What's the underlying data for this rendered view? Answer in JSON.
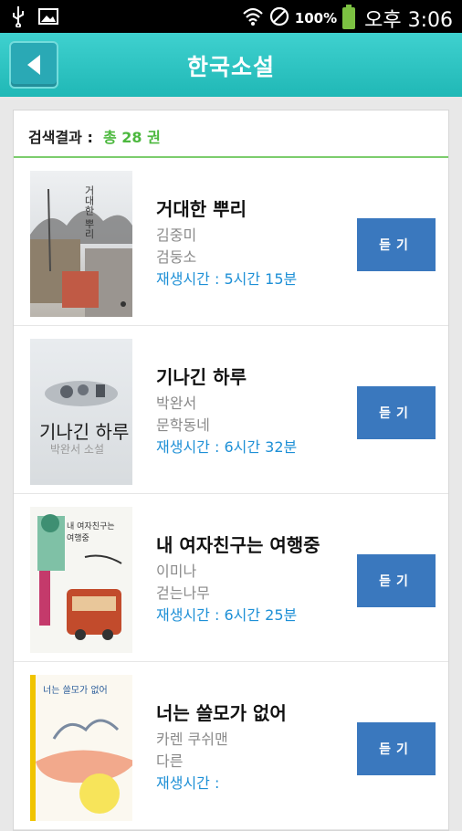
{
  "status": {
    "battery_pct": "100%",
    "time": "오후 3:06"
  },
  "header": {
    "title": "한국소설"
  },
  "results": {
    "label": "검색결과 :",
    "count": "총 28 권"
  },
  "books": [
    {
      "title": "거대한 뿌리",
      "author": "김중미",
      "publisher": "검둥소",
      "duration": "재생시간 : 5시간 15분",
      "button": "듣기",
      "cover_text": "거대한 뿌리"
    },
    {
      "title": "기나긴 하루",
      "author": "박완서",
      "publisher": "문학동네",
      "duration": "재생시간 : 6시간 32분",
      "button": "듣기",
      "cover_text": "기나긴 하루",
      "cover_sub": "박완서 소설"
    },
    {
      "title": "내 여자친구는 여행중",
      "author": "이미나",
      "publisher": "걷는나무",
      "duration": "재생시간 : 6시간 25분",
      "button": "듣기",
      "cover_text": "내 여자친구는 여행중"
    },
    {
      "title": "너는 쓸모가 없어",
      "author": "카렌 쿠쉬맨",
      "publisher": "다른",
      "duration": "재생시간 :",
      "button": "듣기",
      "cover_text": "너는 쓸모가 없어"
    }
  ]
}
